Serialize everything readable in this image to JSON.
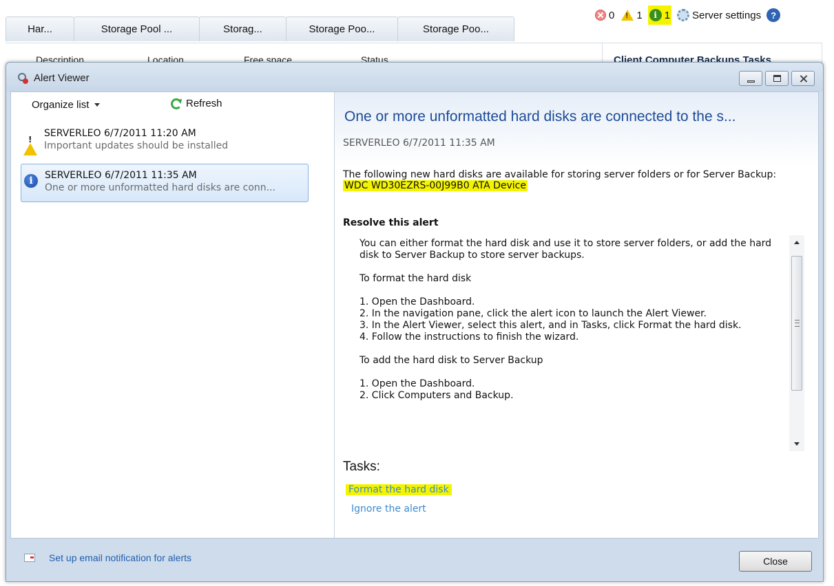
{
  "background": {
    "tabs": [
      "Har...",
      "Storage Pool ...",
      "Storag...",
      "Storage Poo...",
      "Storage Poo..."
    ],
    "status": {
      "errors": "0",
      "warnings": "1",
      "info": "1",
      "server_settings": "Server settings"
    },
    "columns": [
      "Description",
      "Location",
      "Free space",
      "Status"
    ],
    "tasks_header": "Client Computer Backups Tasks"
  },
  "window": {
    "title": "Alert Viewer"
  },
  "left": {
    "organize_label": "Organize list",
    "refresh_label": "Refresh",
    "alerts": [
      {
        "title": "SERVERLEO 6/7/2011 11:20 AM",
        "subtitle": "Important updates should be installed",
        "icon": "warning-icon"
      },
      {
        "title": "SERVERLEO 6/7/2011 11:35 AM",
        "subtitle": "One or more unformatted hard disks are conn...",
        "icon": "info-icon"
      }
    ]
  },
  "detail": {
    "title": "One or more unformatted hard disks are connected to the s...",
    "meta": "SERVERLEO 6/7/2011 11:35 AM",
    "description": "The following new hard disks are available for storing server folders or for Server Backup:",
    "device": "WDC WD30EZRS-00J99B0 ATA Device",
    "resolve_heading": "Resolve this alert",
    "resolve_text": [
      "You can either format the hard disk and use it to store server folders, or add the hard disk to Server Backup to store server backups.",
      "",
      "To format the hard disk",
      "",
      "1. Open the Dashboard.",
      "2. In the navigation pane, click the alert icon to launch the Alert Viewer.",
      "3. In the Alert Viewer, select this alert, and in Tasks, click Format the hard disk.",
      "4. Follow the instructions to finish the wizard.",
      "",
      "To add the hard disk to Server Backup",
      "",
      "1. Open the Dashboard.",
      "2. Click Computers and Backup."
    ],
    "tasks_heading": "Tasks:",
    "task_format": "Format the hard disk",
    "task_ignore": "Ignore the alert"
  },
  "footer": {
    "email_link": "Set up email notification for alerts",
    "close_label": "Close"
  }
}
